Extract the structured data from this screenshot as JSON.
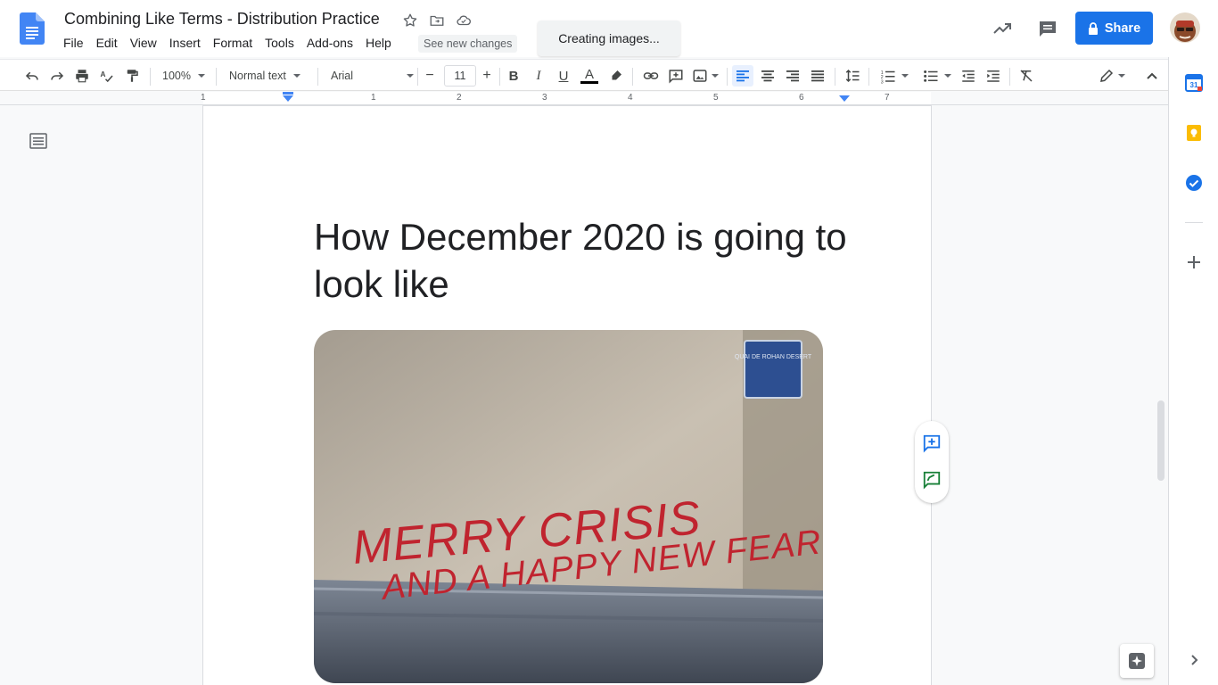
{
  "document": {
    "title": "Combining Like Terms - Distribution Practice",
    "heading": "How December 2020 is going to look like"
  },
  "menu": [
    "File",
    "Edit",
    "View",
    "Insert",
    "Format",
    "Tools",
    "Add-ons",
    "Help"
  ],
  "see_new_changes": "See new changes",
  "toast": "Creating images...",
  "share": {
    "label": "Share"
  },
  "toolbar": {
    "zoom": "100%",
    "style": "Normal text",
    "font": "Arial",
    "font_size": "11"
  },
  "ruler": [
    "1",
    "1",
    "2",
    "3",
    "4",
    "5",
    "6",
    "7"
  ],
  "meme": {
    "line1": "MERRY CRISIS",
    "line2": "AND A HAPPY NEW FEAR",
    "sign": "QUAI DE ROHAN DESERT"
  },
  "sidepanel": {
    "calendar_day": "31"
  },
  "colors": {
    "accent": "#1a73e8",
    "graffiti": "#c0242f",
    "text_color_bar": "#000000"
  }
}
